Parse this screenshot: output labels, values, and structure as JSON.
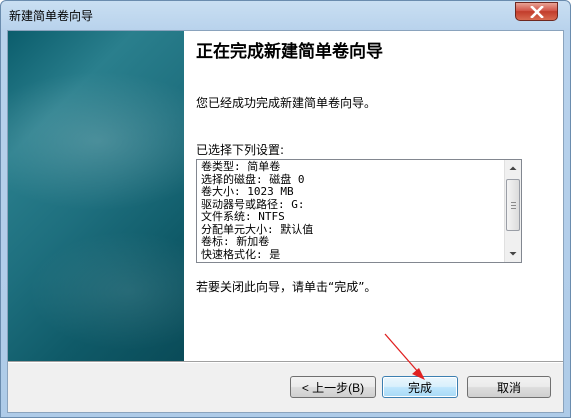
{
  "window": {
    "title": "新建简单卷向导"
  },
  "page": {
    "heading": "正在完成新建简单卷向导",
    "intro": "您已经成功完成新建简单卷向导。",
    "settings_label": "已选择下列设置:",
    "settings": [
      "卷类型: 简单卷",
      "选择的磁盘: 磁盘 0",
      "卷大小: 1023 MB",
      "驱动器号或路径: G:",
      "文件系统: NTFS",
      "分配单元大小: 默认值",
      "卷标: 新加卷",
      "快速格式化: 是"
    ],
    "closing": "若要关闭此向导，请单击“完成”。"
  },
  "buttons": {
    "back": "< 上一步(B)",
    "finish": "完成",
    "cancel": "取消"
  },
  "colors": {
    "banner": "#1e6f7e",
    "annotation_arrow": "#e02020",
    "close_button": "#c23c2b"
  }
}
